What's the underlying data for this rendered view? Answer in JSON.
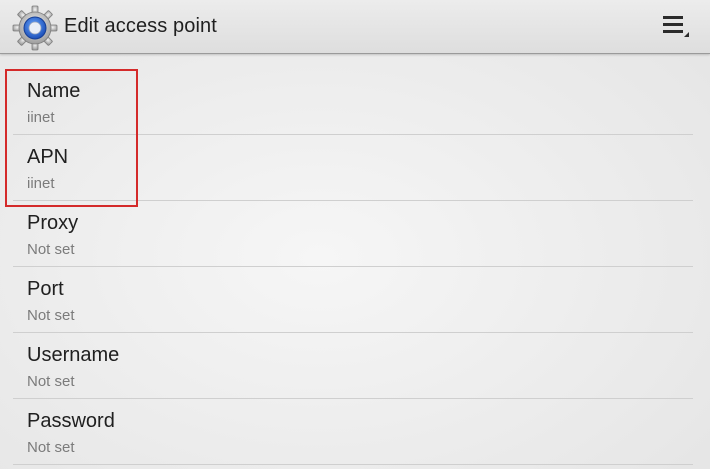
{
  "action_bar": {
    "title": "Edit access point",
    "app_icon": "settings-gear-icon",
    "menu_icon": "overflow-menu-icon"
  },
  "preferences": [
    {
      "title": "Name",
      "summary": "iinet"
    },
    {
      "title": "APN",
      "summary": "iinet"
    },
    {
      "title": "Proxy",
      "summary": "Not set"
    },
    {
      "title": "Port",
      "summary": "Not set"
    },
    {
      "title": "Username",
      "summary": "Not set"
    },
    {
      "title": "Password",
      "summary": "Not set"
    }
  ],
  "colors": {
    "highlight": "#d42a2a",
    "title_text": "#202020",
    "summary_text": "#7b7b7b"
  }
}
